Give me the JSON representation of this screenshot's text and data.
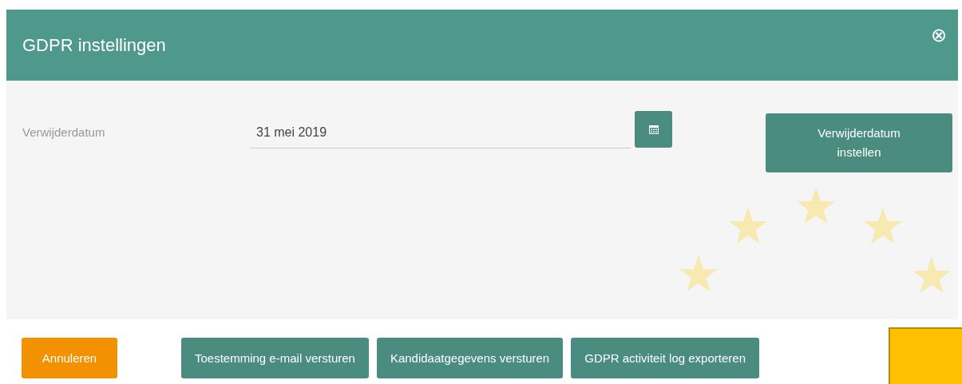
{
  "dialog": {
    "title": "GDPR instellingen",
    "close_symbol": "⊗"
  },
  "field": {
    "label": "Verwijderdatum",
    "value": "31 mei 2019"
  },
  "set_button": "Verwijderdatum instellen",
  "footer_buttons": [
    {
      "label": "Annuleren",
      "kind": "cancel"
    },
    {
      "label": "Toestemming e-mail versturen",
      "kind": "action"
    },
    {
      "label": "Kandidaatgegevens versturen",
      "kind": "action"
    },
    {
      "label": "GDPR activiteit log exporteren",
      "kind": "action"
    }
  ]
}
